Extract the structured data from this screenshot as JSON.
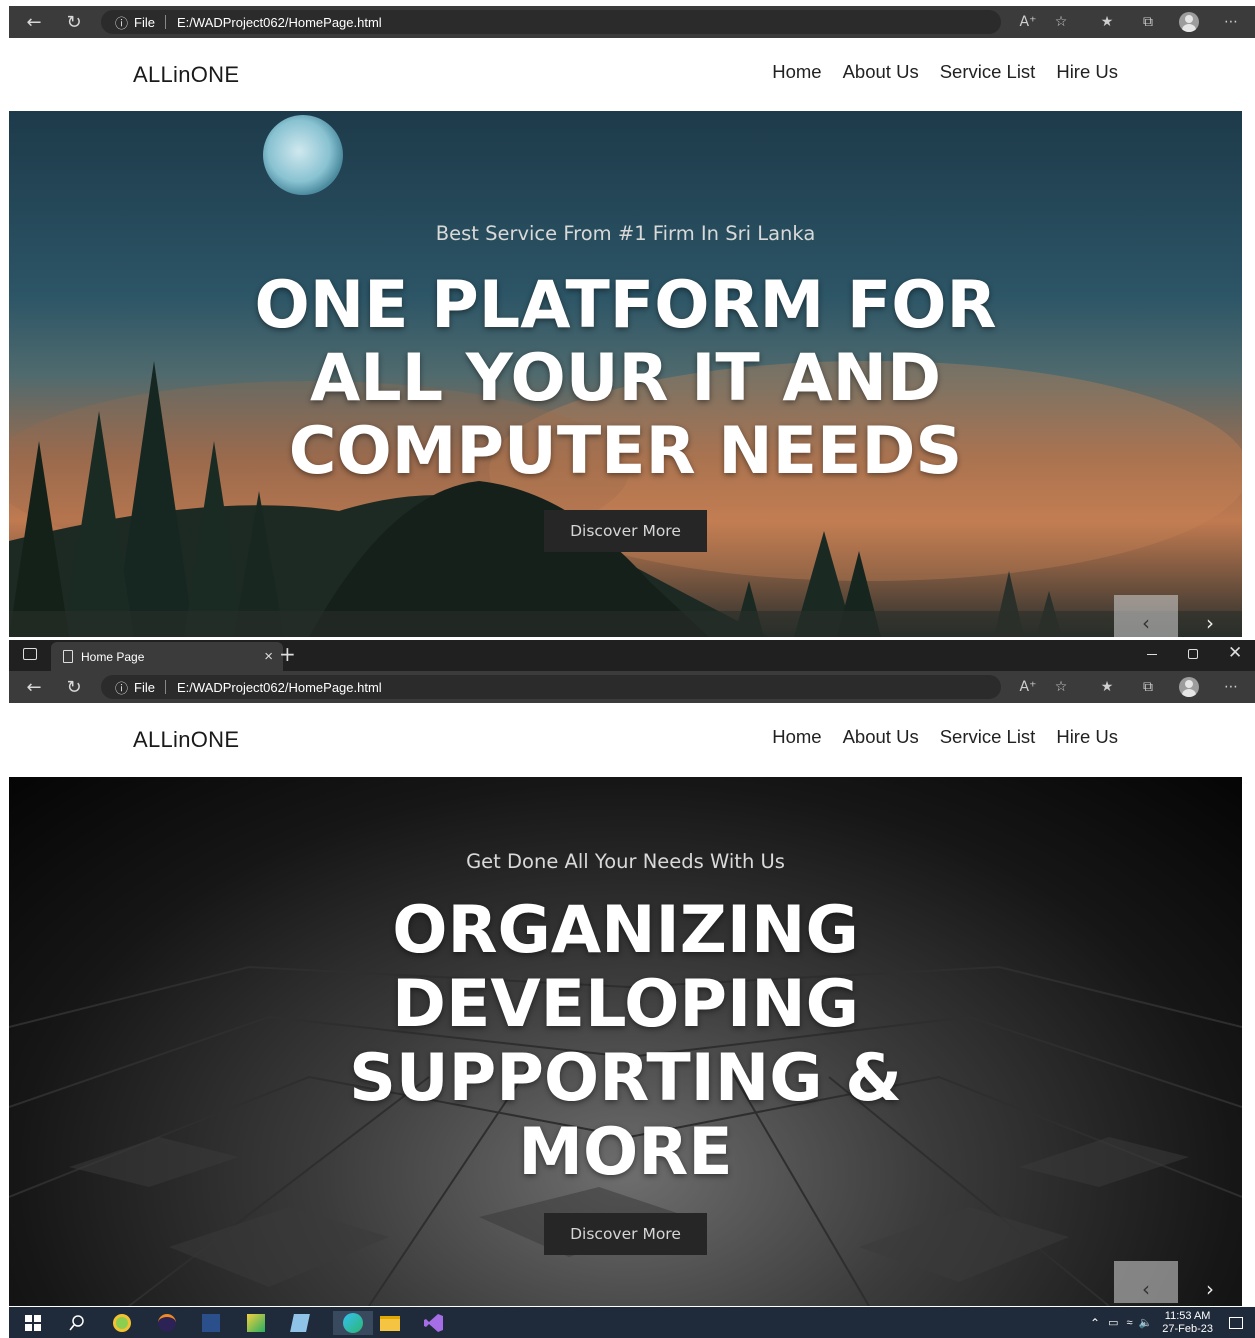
{
  "browser": {
    "tab_title": "Home Page",
    "url_info_label": "File",
    "url_path": "E:/WADProject062/HomePage.html",
    "new_tab_symbol": "+",
    "tab_close_symbol": "×"
  },
  "site": {
    "logo": "ALLinONE",
    "nav": [
      "Home",
      "About Us",
      "Service List",
      "Hire Us"
    ]
  },
  "slide1": {
    "subtitle": "Best Service From #1 Firm In Sri Lanka",
    "headline": [
      "ONE PLATFORM FOR",
      "ALL YOUR IT AND",
      "COMPUTER NEEDS"
    ],
    "button": "Discover More"
  },
  "slide2": {
    "subtitle": "Get Done All Your Needs With Us",
    "headline": [
      "ORGANIZING",
      "DEVELOPING",
      "SUPPORTING &",
      "MORE"
    ],
    "button": "Discover More"
  },
  "carousel": {
    "prev_symbol": "‹",
    "next_symbol": "›"
  },
  "taskbar": {
    "time": "11:53 AM",
    "date": "27-Feb-23"
  },
  "icons": {
    "back": "back-arrow-icon",
    "refresh": "refresh-icon",
    "info": "info-icon",
    "read_aloud": "read-aloud-icon",
    "favorite_add": "add-favorite-icon",
    "favorites": "favorites-icon",
    "collections": "collections-icon",
    "profile": "profile-icon",
    "more": "more-icon"
  },
  "colors": {
    "chrome_bar": "#3b3b3b",
    "address_field": "#2b2b2b",
    "tab_strip": "#202020",
    "taskbar": "#1f2a3a",
    "cta_button": "#262626"
  }
}
